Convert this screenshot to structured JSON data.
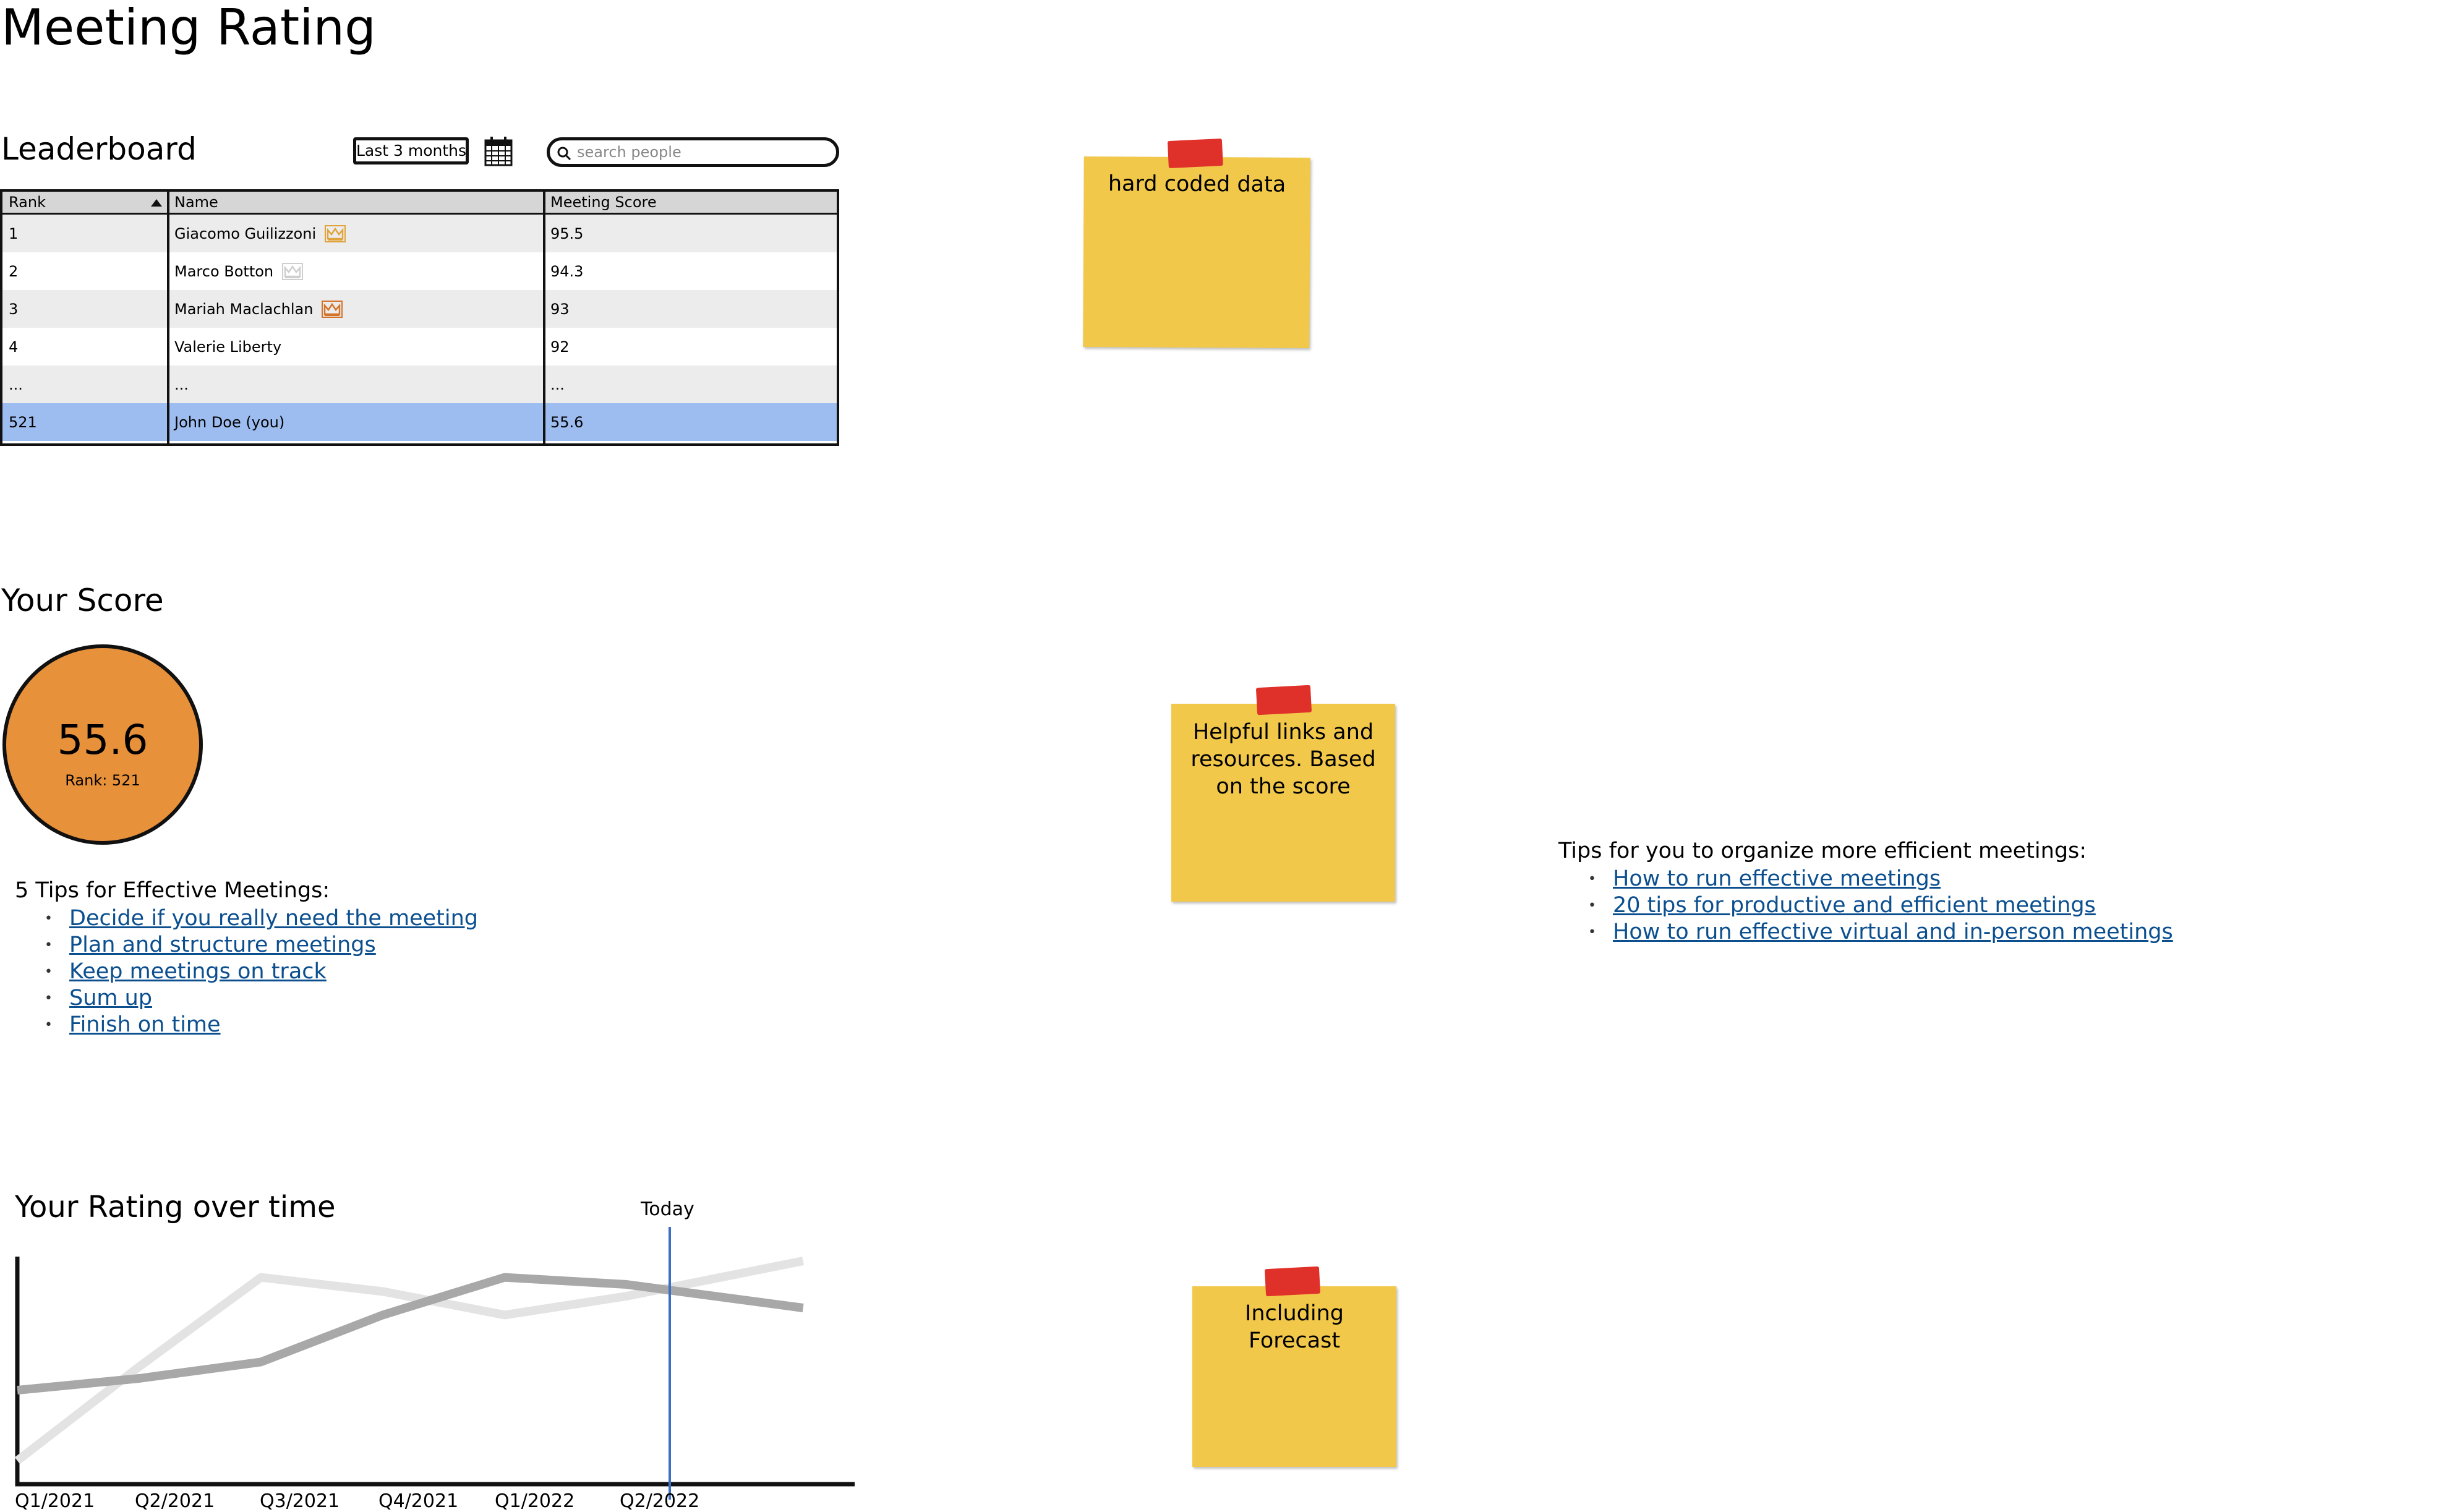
{
  "page": {
    "title": "Meeting Rating"
  },
  "leaderboard": {
    "title": "Leaderboard",
    "range_label": "Last 3 months",
    "search_placeholder": "search people",
    "columns": [
      "Rank",
      "Name",
      "Meeting Score"
    ],
    "rows": [
      {
        "rank": "1",
        "name": "Giacomo Guilizzoni",
        "score": "95.5",
        "crown": "gold"
      },
      {
        "rank": "2",
        "name": "Marco Botton",
        "score": "94.3",
        "crown": "silver"
      },
      {
        "rank": "3",
        "name": "Mariah Maclachlan",
        "score": "93",
        "crown": "bronze"
      },
      {
        "rank": "4",
        "name": "Valerie Liberty",
        "score": "92",
        "crown": ""
      },
      {
        "rank": "...",
        "name": "...",
        "score": "...",
        "crown": ""
      },
      {
        "rank": "521",
        "name": "John Doe (you)",
        "score": "55.6",
        "crown": "",
        "highlight": true
      }
    ],
    "colors": {
      "stripe": "#ececec",
      "highlight": "#9dbdf0",
      "gold": "#e2a33b",
      "silver": "#cfcfcf",
      "bronze": "#d4732a"
    }
  },
  "score": {
    "title": "Your Score",
    "value": "55.6",
    "rank_text": "Rank: 521",
    "color": "#e8913b"
  },
  "tips": {
    "title": "5 Tips for Effective Meetings:",
    "items": [
      "Decide if you really need the meeting",
      "Plan and structure meetings",
      "Keep meetings on track",
      "Sum up",
      "Finish on time"
    ]
  },
  "resources": {
    "title": "Tips for you to organize more efficient meetings:",
    "items": [
      "How to run effective meetings",
      "20 tips for productive and efficient meetings",
      "How to run effective virtual and in-person meetings"
    ]
  },
  "notes": {
    "n1": "hard coded data",
    "n2": "Helpful links and resources. Based on the score",
    "n3": "Including Forecast"
  },
  "chart_data": {
    "type": "line",
    "title": "Your Rating over time",
    "categories": [
      "Q1/2021",
      "Q2/2021",
      "Q3/2021",
      "Q4/2021",
      "Q1/2022",
      "Q2/2022"
    ],
    "marker_label": "Today",
    "marker_category": "Q2/2022",
    "series": [
      {
        "values": [
          10,
          50,
          88,
          82,
          72,
          80,
          95
        ],
        "color": "#e3e3e3"
      },
      {
        "values": [
          40,
          45,
          52,
          72,
          88,
          85,
          75
        ],
        "color": "#a8a8a8"
      }
    ],
    "x_points": [
      0,
      1,
      2,
      3,
      4,
      5,
      6.45
    ],
    "ylim": [
      0,
      100
    ],
    "marker_color": "#3d6fc4"
  }
}
